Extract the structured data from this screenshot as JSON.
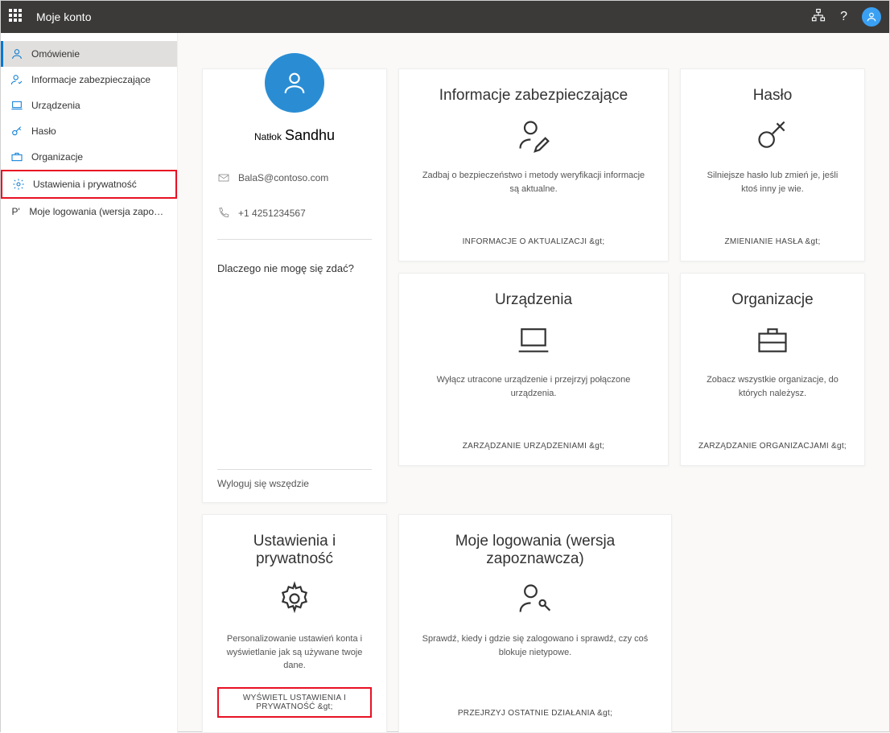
{
  "header": {
    "title": "Moje konto"
  },
  "sidebar": {
    "items": [
      {
        "label": "Omówienie"
      },
      {
        "label": "Informacje zabezpieczające"
      },
      {
        "label": "Urządzenia"
      },
      {
        "label": "Hasło"
      },
      {
        "label": "Organizacje"
      },
      {
        "label": "Ustawienia i prywatność"
      },
      {
        "label": "Moje logowania (wersja zapoznawcza)"
      }
    ]
  },
  "profile": {
    "name_prefix": "Natłok",
    "name": "Sandhu",
    "email": "BalaS@contoso.com",
    "phone": "+1 4251234567",
    "question": "Dlaczego nie mogę się zdać?",
    "signout": "Wyloguj się wszędzie"
  },
  "tiles": {
    "security": {
      "title": "Informacje zabezpieczające",
      "desc": "Zadbaj o bezpieczeństwo i metody weryfikacji informacje są aktualne.",
      "action": "INFORMACJE O AKTUALIZACJI &gt;"
    },
    "password": {
      "title": "Hasło",
      "desc": "Silniejsze hasło lub zmień je, jeśli ktoś inny je wie.",
      "action": "ZMIENIANIE HASŁA &gt;"
    },
    "devices": {
      "title": "Urządzenia",
      "desc": "Wyłącz utracone urządzenie i przejrzyj połączone urządzenia.",
      "action": "ZARZĄDZANIE URZĄDZENIAMI &gt;"
    },
    "orgs": {
      "title": "Organizacje",
      "desc": "Zobacz wszystkie organizacje, do których należysz.",
      "action": "ZARZĄDZANIE ORGANIZACJAMI &gt;"
    },
    "settings": {
      "title": "Ustawienia i prywatność",
      "desc": "Personalizowanie ustawień konta i wyświetlanie jak są używane twoje dane.",
      "action": "WYŚWIETL USTAWIENIA I PRYWATNOŚĆ &gt;"
    },
    "signins": {
      "title": "Moje logowania (wersja zapoznawcza)",
      "desc": "Sprawdź, kiedy i gdzie się zalogowano i sprawdź, czy coś blokuje nietypowe.",
      "action": "PRZEJRZYJ OSTATNIE DZIAŁANIA &gt;"
    }
  }
}
